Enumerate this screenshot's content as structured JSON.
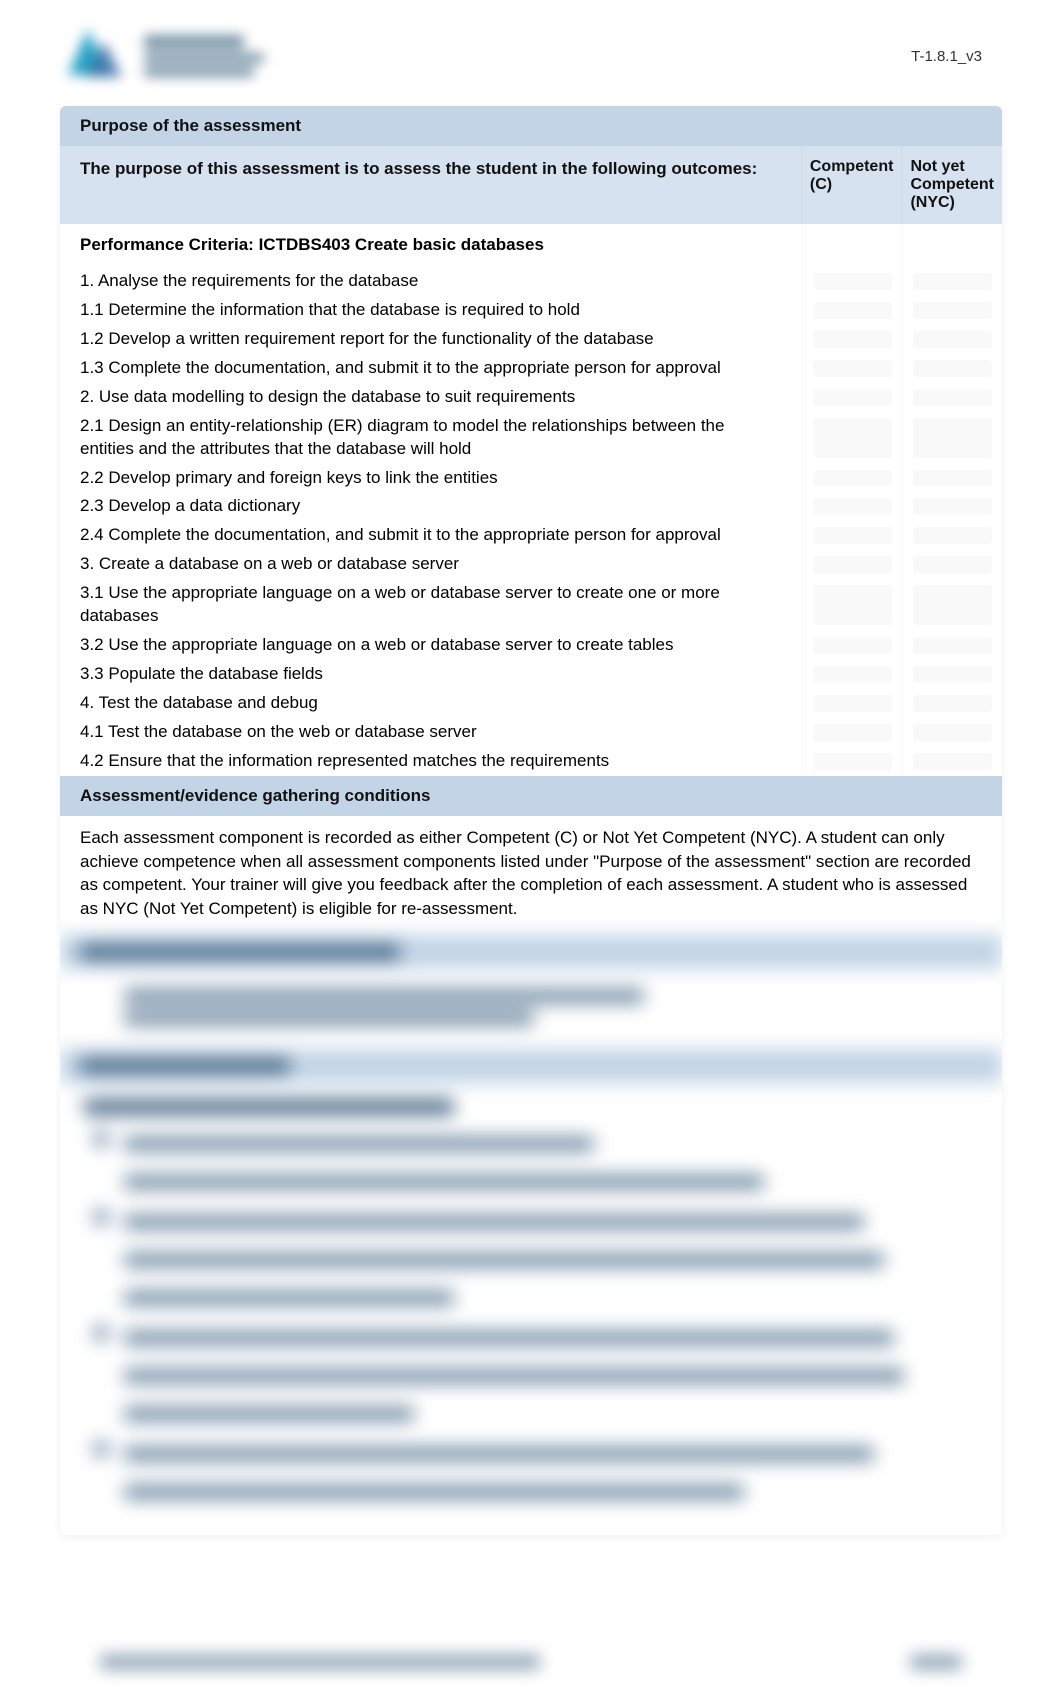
{
  "doc_id": "T-1.8.1_v3",
  "sections": {
    "purpose_title": "Purpose of the assessment",
    "purpose_intro": "The purpose of this assessment is to assess the student in the following outcomes:",
    "col_c": "Competent (C)",
    "col_nyc": "Not yet Competent (NYC)",
    "criteria_title": "Performance Criteria: ICTDBS403 Create basic databases",
    "criteria": [
      "1. Analyse the requirements for the database",
      "1.1 Determine the information that the database is required to hold",
      "1.2 Develop a written requirement report for the functionality of the database",
      "1.3 Complete the documentation, and submit it to the appropriate person for approval",
      "2. Use data modelling to design the database to suit requirements",
      "2.1 Design an entity-relationship (ER) diagram to model the relationships between the entities and the attributes that the database will hold",
      "2.2 Develop primary and foreign keys to link the entities",
      "2.3 Develop a data dictionary",
      "2.4 Complete the documentation, and submit it to the appropriate person for approval",
      "3. Create a database on a web or database server",
      "3.1 Use the appropriate language on a web or database server to create one or more databases",
      "3.2 Use the appropriate language on a web or database server to create tables",
      "3.3 Populate the database fields",
      "4. Test the database and debug",
      "4.1 Test the database on the web or database server",
      "4.2 Ensure that the information represented matches the requirements"
    ],
    "conditions_title": "Assessment/evidence gathering conditions",
    "conditions_text": "Each assessment component is recorded as either Competent (C) or Not Yet Competent (NYC). A student can only achieve competence when all assessment components listed under \"Purpose of the assessment\" section are recorded as competent. Your trainer will give you feedback after the completion of each assessment. A student who is assessed as NYC (Not Yet Competent) is eligible for re-assessment."
  }
}
